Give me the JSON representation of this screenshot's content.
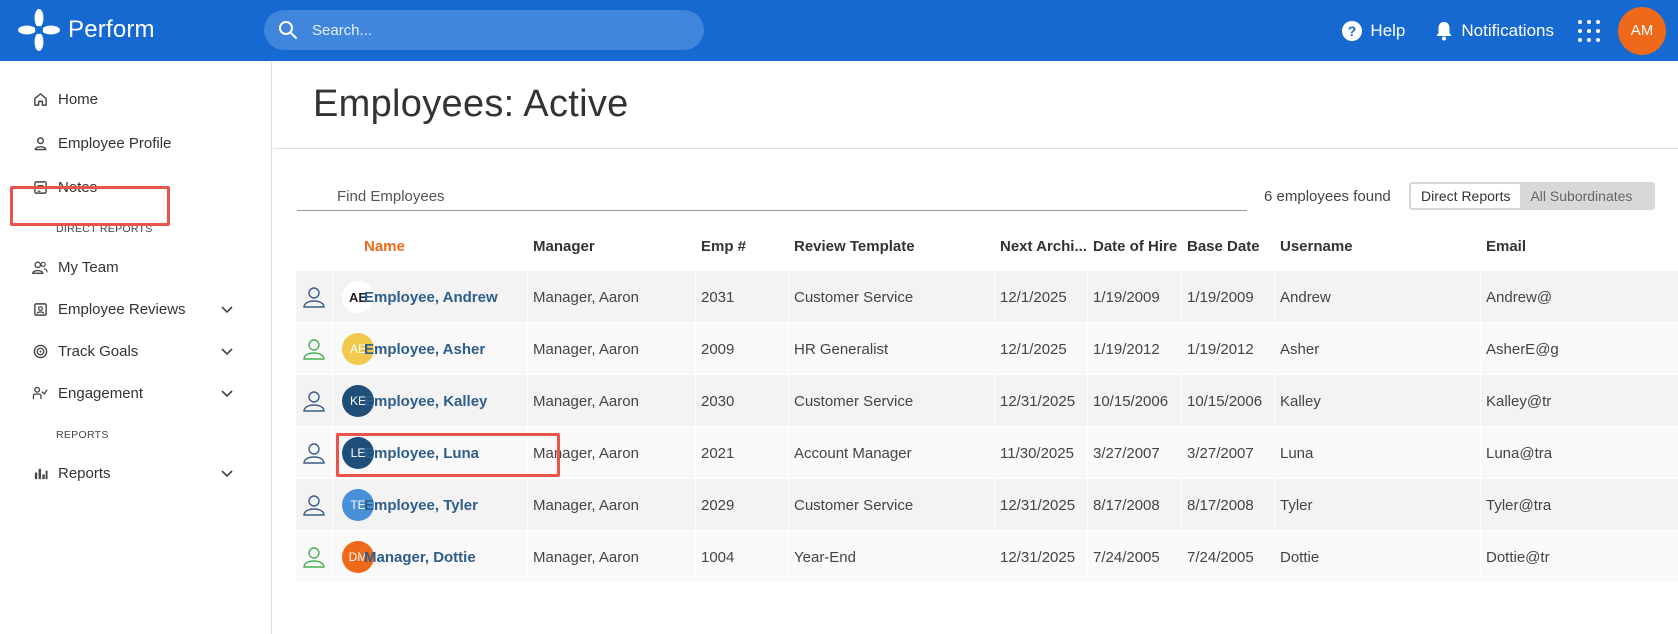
{
  "app": {
    "name": "Perform"
  },
  "topbar": {
    "search_placeholder": "Search...",
    "help_label": "Help",
    "notifications_label": "Notifications",
    "user_initials": "AM"
  },
  "sidebar": {
    "items": [
      {
        "label": "Home",
        "icon": "home-icon"
      },
      {
        "label": "Employee Profile",
        "icon": "person-icon"
      },
      {
        "label": "Notes",
        "icon": "notes-icon"
      },
      {
        "label": "My Team",
        "icon": "team-icon"
      },
      {
        "label": "Employee Reviews",
        "icon": "review-icon"
      },
      {
        "label": "Track Goals",
        "icon": "target-icon"
      },
      {
        "label": "Engagement",
        "icon": "engagement-icon"
      },
      {
        "label": "Reports",
        "icon": "reports-icon"
      }
    ],
    "section_direct_reports": "DIRECT REPORTS",
    "section_reports": "REPORTS"
  },
  "main": {
    "title": "Employees: Active",
    "find_placeholder": "Find Employees",
    "count_text": "6 employees found",
    "toggle": {
      "direct": "Direct Reports",
      "all": "All Subordinates"
    },
    "columns": [
      "Name",
      "Manager",
      "Emp #",
      "Review Template",
      "Next Archi...",
      "Date of Hire",
      "Base Date",
      "Username",
      "Email"
    ],
    "rows": [
      {
        "initials": "AE",
        "avatar_color": "#ffffff",
        "avatar_text": "#222222",
        "status_color": "#3a5e8a",
        "name": "Employee, Andrew",
        "manager": "Manager, Aaron",
        "emp": "2031",
        "template": "Customer Service",
        "next": "12/1/2025",
        "hire": "1/19/2009",
        "base": "1/19/2009",
        "username": "Andrew",
        "email": "Andrew@"
      },
      {
        "initials": "AE",
        "avatar_color": "#f2c94c",
        "avatar_text": "#ffffff",
        "status_color": "#4caf50",
        "name": "Employee, Asher",
        "manager": "Manager, Aaron",
        "emp": "2009",
        "template": "HR Generalist",
        "next": "12/1/2025",
        "hire": "1/19/2012",
        "base": "1/19/2012",
        "username": "Asher",
        "email": "AsherE@g"
      },
      {
        "initials": "KE",
        "avatar_color": "#1f4e79",
        "avatar_text": "#ffffff",
        "status_color": "#3a5e8a",
        "name": "Employee, Kalley",
        "manager": "Manager, Aaron",
        "emp": "2030",
        "template": "Customer Service",
        "next": "12/31/2025",
        "hire": "10/15/2006",
        "base": "10/15/2006",
        "username": "Kalley",
        "email": "Kalley@tr"
      },
      {
        "initials": "LE",
        "avatar_color": "#1f4e79",
        "avatar_text": "#ffffff",
        "status_color": "#3a5e8a",
        "name": "Employee, Luna",
        "manager": "Manager, Aaron",
        "emp": "2021",
        "template": "Account Manager",
        "next": "11/30/2025",
        "hire": "3/27/2007",
        "base": "3/27/2007",
        "username": "Luna",
        "email": "Luna@tra"
      },
      {
        "initials": "TE",
        "avatar_color": "#4a90d9",
        "avatar_text": "#ffffff",
        "status_color": "#3a5e8a",
        "name": "Employee, Tyler",
        "manager": "Manager, Aaron",
        "emp": "2029",
        "template": "Customer Service",
        "next": "12/31/2025",
        "hire": "8/17/2008",
        "base": "8/17/2008",
        "username": "Tyler",
        "email": "Tyler@tra"
      },
      {
        "initials": "DM",
        "avatar_color": "#ee6a1a",
        "avatar_text": "#ffffff",
        "status_color": "#4caf50",
        "name": "Manager, Dottie",
        "manager": "Manager, Aaron",
        "emp": "1004",
        "template": "Year-End",
        "next": "12/31/2025",
        "hire": "7/24/2005",
        "base": "7/24/2005",
        "username": "Dottie",
        "email": "Dottie@tr"
      }
    ]
  },
  "colors": {
    "topbar": "#1569d1",
    "accent": "#ee6a1a",
    "link": "#2d5d8a",
    "highlight": "#e8534a"
  }
}
